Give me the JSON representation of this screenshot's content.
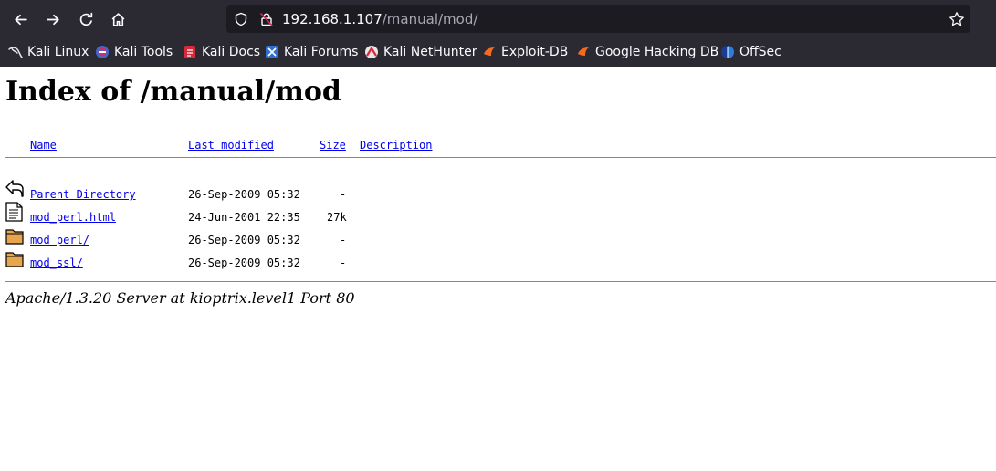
{
  "browser": {
    "url_host": "192.168.1.107",
    "url_path": "/manual/mod/",
    "bookmarks": [
      {
        "label": "Kali Linux",
        "icon": "kali-dragon-icon"
      },
      {
        "label": "Kali Tools",
        "icon": "kali-tools-icon"
      },
      {
        "label": "Kali Docs",
        "icon": "kali-docs-icon"
      },
      {
        "label": "Kali Forums",
        "icon": "kali-forums-icon"
      },
      {
        "label": "Kali NetHunter",
        "icon": "nethunter-icon"
      },
      {
        "label": "Exploit-DB",
        "icon": "exploitdb-icon"
      },
      {
        "label": "Google Hacking DB",
        "icon": "ghdb-icon"
      },
      {
        "label": "OffSec",
        "icon": "offsec-icon"
      }
    ],
    "colors": {
      "chrome": "#2b2a33",
      "urlbar": "#1c1b22",
      "text": "#fbfbfe"
    }
  },
  "page": {
    "title": "Index of /manual/mod",
    "headers": {
      "name": "Name",
      "last_modified": "Last modified",
      "size": "Size",
      "description": "Description"
    },
    "rows": [
      {
        "icon": "back-arrow-icon",
        "name": "Parent Directory",
        "modified": "26-Sep-2009 05:32",
        "size": "-"
      },
      {
        "icon": "text-file-icon",
        "name": "mod_perl.html",
        "modified": "24-Jun-2001 22:35",
        "size": "27k"
      },
      {
        "icon": "folder-icon",
        "name": "mod_perl/",
        "modified": "26-Sep-2009 05:32",
        "size": "-"
      },
      {
        "icon": "folder-icon",
        "name": "mod_ssl/",
        "modified": "26-Sep-2009 05:32",
        "size": "-"
      }
    ],
    "footer": "Apache/1.3.20 Server at kioptrix.level1 Port 80",
    "colors": {
      "link": "#0000ee",
      "visited": "#551a8b"
    }
  }
}
